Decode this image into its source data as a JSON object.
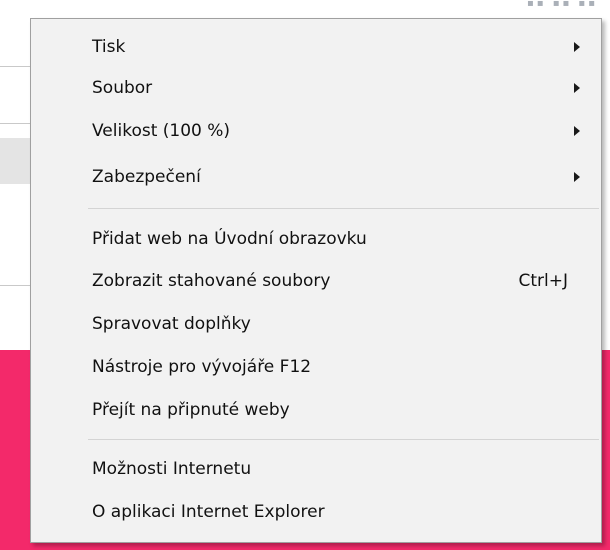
{
  "menu": {
    "groups": [
      {
        "items": [
          {
            "label": "Tisk",
            "submenu": true
          },
          {
            "label": "Soubor",
            "submenu": true
          },
          {
            "label": "Velikost (100 %)",
            "submenu": true
          },
          {
            "label": "Zabezpečení",
            "submenu": true
          }
        ]
      },
      {
        "items": [
          {
            "label": "Přidat web na Úvodní obrazovku"
          },
          {
            "label": "Zobrazit stahované soubory",
            "shortcut": "Ctrl+J"
          },
          {
            "label": "Spravovat doplňky"
          },
          {
            "label": "Nástroje pro vývojáře F12"
          },
          {
            "label": "Přejít na připnuté weby"
          }
        ]
      },
      {
        "items": [
          {
            "label": "Možnosti Internetu"
          },
          {
            "label": "O aplikaci Internet Explorer"
          }
        ]
      }
    ]
  },
  "colors": {
    "menu_background": "#f2f2f2",
    "menu_border": "#a0a0a0",
    "separator": "#d4d4d4",
    "background_accent": "#f3296a"
  }
}
